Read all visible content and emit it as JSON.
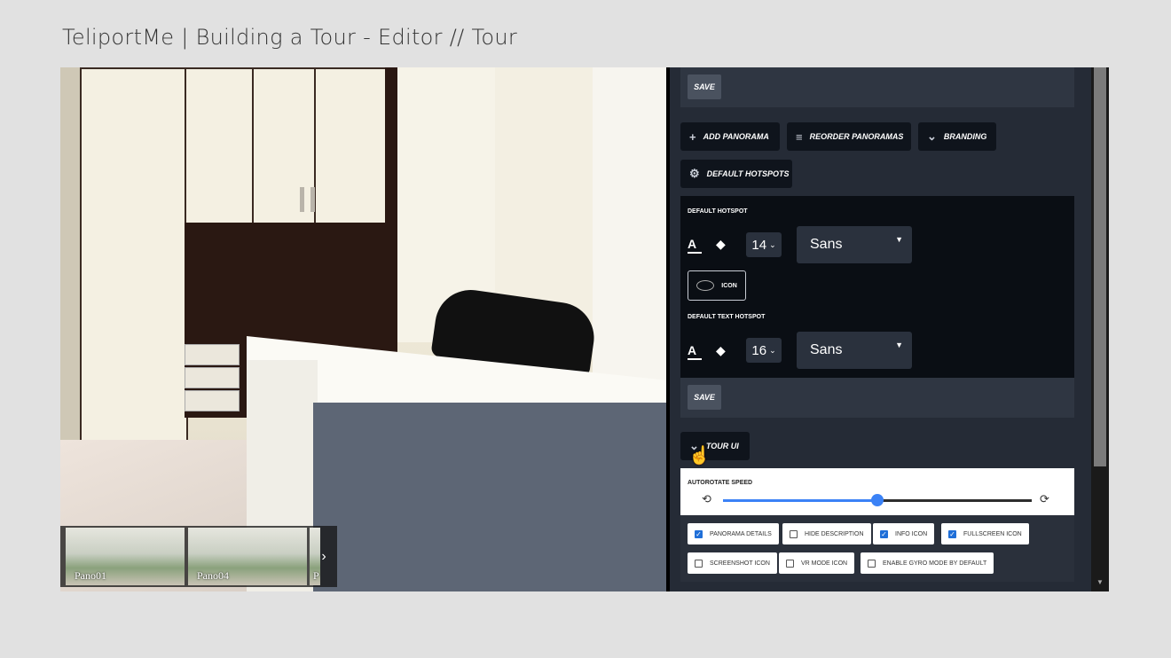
{
  "slide_title": "TeliportMe | Building a Tour - Editor // Tour",
  "thumbnails": [
    {
      "label": "Pano01"
    },
    {
      "label": "Pano04"
    },
    {
      "label": "P"
    }
  ],
  "thumbnail_next_icon": "chevron-right-icon",
  "panel": {
    "save_label": "SAVE",
    "buttons": {
      "add_panorama": "ADD PANORAMA",
      "reorder_panoramas": "REORDER PANORAMAS",
      "branding": "BRANDING",
      "default_hotspots": "DEFAULT HOTSPOTS",
      "tour_ui": "TOUR UI"
    },
    "default_hotspot": {
      "heading": "DEFAULT HOTSPOT",
      "font_size": "14",
      "font": "Sans",
      "icon_label": "ICON"
    },
    "default_text_hotspot": {
      "heading": "DEFAULT TEXT HOTSPOT",
      "font_size": "16",
      "font": "Sans"
    },
    "tour_ui": {
      "autorotate_label": "AUTOROTATE SPEED",
      "autorotate_value": 0.5,
      "options": [
        {
          "label": "PANORAMA DETAILS",
          "checked": true
        },
        {
          "label": "HIDE DESCRIPTION",
          "checked": false
        },
        {
          "label": "INFO ICON",
          "checked": true
        },
        {
          "label": "FULLSCREEN ICON",
          "checked": true
        },
        {
          "label": "SCREENSHOT ICON",
          "checked": false
        },
        {
          "label": "VR MODE ICON",
          "checked": false
        },
        {
          "label": "ENABLE GYRO MODE BY DEFAULT",
          "checked": false
        }
      ]
    }
  },
  "colors": {
    "panel_bg": "#252b36",
    "accent_blue": "#3b82f6"
  }
}
